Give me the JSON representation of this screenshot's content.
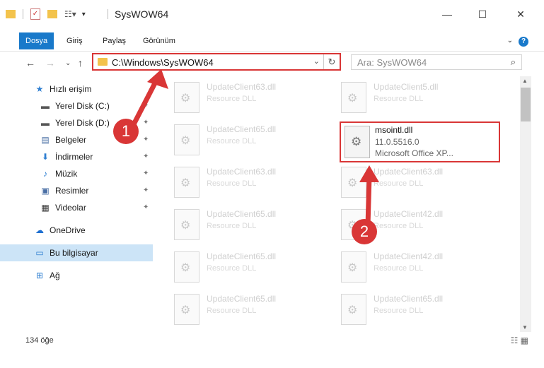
{
  "window": {
    "title": "SysWOW64",
    "minimize": "—",
    "maximize": "☐",
    "close": "✕"
  },
  "ribbon": {
    "tabs": [
      "Dosya",
      "Giriş",
      "Paylaş",
      "Görünüm"
    ],
    "help": "?"
  },
  "address": {
    "path": "C:\\Windows\\SysWOW64",
    "refresh": "↻",
    "dropdown": "⌄"
  },
  "search": {
    "placeholder": "Ara: SysWOW64",
    "icon": "⌕"
  },
  "nav": {
    "back": "←",
    "forward": "→",
    "recent": "⌄",
    "up": "↑"
  },
  "sidebar": {
    "items": [
      {
        "label": "Hızlı erişim",
        "icon": "star-icon",
        "glyph": "★",
        "color": "#2f7fd1"
      },
      {
        "label": "Yerel Disk (C:)",
        "icon": "drive-icon",
        "glyph": "▬",
        "color": "#555555"
      },
      {
        "label": "Yerel Disk (D:)",
        "icon": "drive-icon",
        "glyph": "▬",
        "color": "#555555"
      },
      {
        "label": "Belgeler",
        "icon": "documents-icon",
        "glyph": "▤",
        "color": "#4a6fa5"
      },
      {
        "label": "İndirmeler",
        "icon": "download-icon",
        "glyph": "⬇",
        "color": "#2f7fd1"
      },
      {
        "label": "Müzik",
        "icon": "music-icon",
        "glyph": "♪",
        "color": "#2f7fd1"
      },
      {
        "label": "Resimler",
        "icon": "pictures-icon",
        "glyph": "▣",
        "color": "#4a6fa5"
      },
      {
        "label": "Videolar",
        "icon": "videos-icon",
        "glyph": "▦",
        "color": "#333333"
      },
      {
        "label": "OneDrive",
        "icon": "cloud-icon",
        "glyph": "☁",
        "color": "#1e6fd0"
      },
      {
        "label": "Bu bilgisayar",
        "icon": "computer-icon",
        "glyph": "▭",
        "color": "#2f7fd1"
      },
      {
        "label": "Ağ",
        "icon": "network-icon",
        "glyph": "⊞",
        "color": "#2f7fd1"
      }
    ],
    "pin_glyph": "📌"
  },
  "files": [
    {
      "name": "UpdateClient63.dll",
      "type": "Resource DLL"
    },
    {
      "name": "UpdateClient5.dll",
      "type": "Resource DLL"
    },
    {
      "name": "UpdateClient65.dll",
      "type": "Resource DLL"
    },
    {
      "name": "UpdateClient63.dll",
      "type": "Resource DLL"
    },
    {
      "name": "UpdateClient63.dll",
      "type": "Resource DLL"
    },
    {
      "name": "UpdateClient65.dll",
      "type": "Resource DLL"
    },
    {
      "name": "UpdateClient42.dll",
      "type": "Resource DLL"
    },
    {
      "name": "UpdateClient65.dll",
      "type": "Resource DLL"
    },
    {
      "name": "UpdateClient42.dll",
      "type": "Resource DLL"
    },
    {
      "name": "UpdateClient65.dll",
      "type": "Resource DLL"
    },
    {
      "name": "UpdateClient65.dll",
      "type": "Resource DLL"
    }
  ],
  "selected_file": {
    "name": "msointl.dll",
    "version": "11.0.5516.0",
    "description": "Microsoft Office XP..."
  },
  "status": {
    "count": "134 öğe",
    "views": "☷ ▦"
  },
  "annotations": {
    "badge1": "1",
    "badge2": "2"
  },
  "colors": {
    "accent": "#1979ca",
    "highlight": "#d93636",
    "selected": "#cce4f7"
  }
}
